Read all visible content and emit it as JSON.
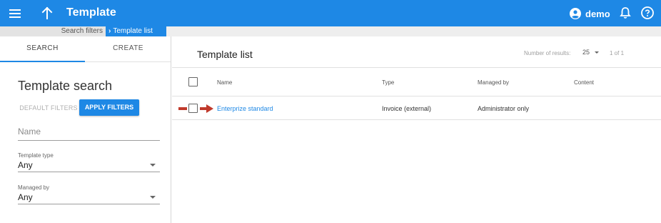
{
  "appbar": {
    "title": "Template",
    "user_name": "demo",
    "colors": {
      "accent": "#1e88e5"
    }
  },
  "breadcrumb": {
    "parent": "Search filters",
    "current": "Template list"
  },
  "left_panel": {
    "tabs": [
      {
        "label": "SEARCH",
        "active": true
      },
      {
        "label": "CREATE",
        "active": false
      }
    ],
    "title": "Template search",
    "default_filters_label": "DEFAULT FILTERS",
    "apply_filters_label": "APPLY FILTERS",
    "name_field": {
      "placeholder": "Name",
      "value": ""
    },
    "template_type": {
      "label": "Template type",
      "value": "Any"
    },
    "managed_by": {
      "label": "Managed by",
      "value": "Any"
    }
  },
  "list": {
    "title": "Template list",
    "results_label": "Number of results:",
    "per_page": "25",
    "pages": "1 of 1",
    "columns": [
      "Name",
      "Type",
      "Managed by",
      "Content"
    ],
    "rows": [
      {
        "name": "Enterprize standard",
        "type": "Invoice (external)",
        "managed_by": "Administrator only",
        "content": ""
      }
    ]
  },
  "icons": [
    "menu-icon",
    "arrow-up-icon",
    "account-circle-icon",
    "bell-icon",
    "help-circle-icon",
    "chevron-right-icon",
    "dropdown-caret-icon",
    "red-pointer-arrow-icon"
  ]
}
